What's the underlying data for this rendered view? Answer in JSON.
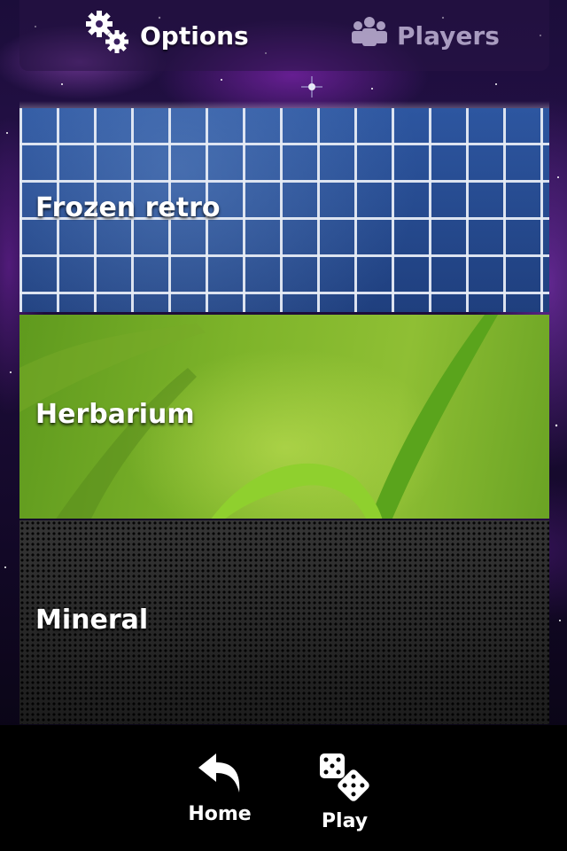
{
  "tabs": {
    "options": {
      "label": "Options",
      "icon": "gears-icon",
      "active": true
    },
    "players": {
      "label": "Players",
      "icon": "people-icon",
      "active": false
    }
  },
  "themes": [
    {
      "label": "Frozen retro",
      "style": "blue-tiles"
    },
    {
      "label": "Herbarium",
      "style": "green-grass"
    },
    {
      "label": "Mineral",
      "style": "dark-metal"
    }
  ],
  "toolbar": {
    "home": {
      "label": "Home",
      "icon": "back-arrow-icon"
    },
    "play": {
      "label": "Play",
      "icon": "dice-icon"
    }
  },
  "colors": {
    "background": "#1b0d3a",
    "accent": "#8a3fc8",
    "text": "#ffffff"
  }
}
